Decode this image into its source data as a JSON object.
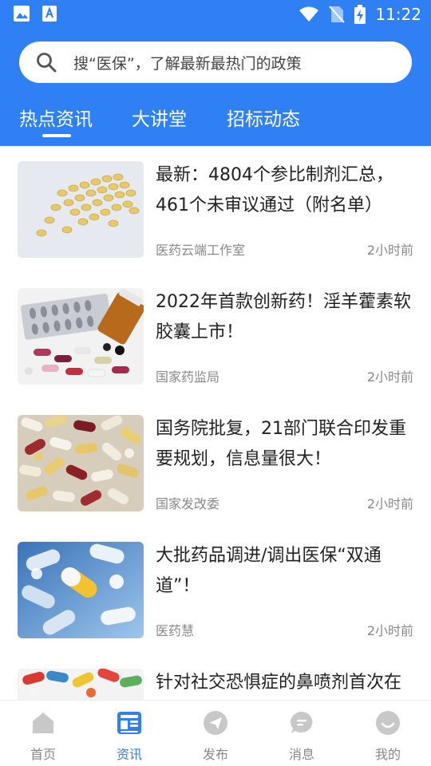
{
  "status_bar": {
    "time": "11:22"
  },
  "search": {
    "placeholder": "搜“医保”，了解最新最热门的政策"
  },
  "tabs": [
    {
      "label": "热点资讯",
      "active": true
    },
    {
      "label": "大讲堂",
      "active": false
    },
    {
      "label": "招标动态",
      "active": false
    }
  ],
  "articles": [
    {
      "title": "最新：4804个参比制剂汇总，461个未审议通过（附名单）",
      "source": "医药云端工作室",
      "time": "2小时前"
    },
    {
      "title": "2022年首款创新药！淫羊藿素软胶囊上市！",
      "source": "国家药监局",
      "time": "2小时前"
    },
    {
      "title": "国务院批复，21部门联合印发重要规划，信息量很大！",
      "source": "国家发改委",
      "time": "2小时前"
    },
    {
      "title": "大批药品调进/调出医保“双通道”！",
      "source": "医药慧",
      "time": "2小时前"
    },
    {
      "title": "针对社交恐惧症的鼻喷剂首次在",
      "source": "",
      "time": ""
    }
  ],
  "bottom_nav": [
    {
      "label": "首页",
      "icon": "home-icon",
      "active": false
    },
    {
      "label": "资讯",
      "icon": "news-icon",
      "active": true
    },
    {
      "label": "发布",
      "icon": "send-icon",
      "active": false
    },
    {
      "label": "消息",
      "icon": "message-icon",
      "active": false
    },
    {
      "label": "我的",
      "icon": "profile-icon",
      "active": false
    }
  ],
  "colors": {
    "primary": "#2f80f4",
    "nav_inactive": "#c8c8c8"
  }
}
